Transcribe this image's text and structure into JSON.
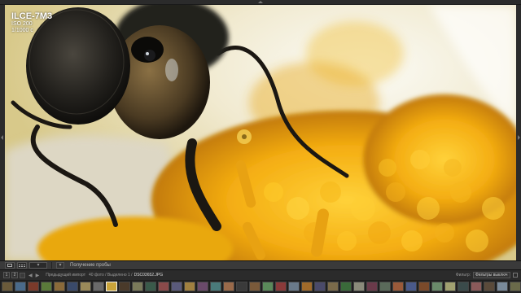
{
  "photo_info": {
    "camera": "ILCE-7M3",
    "iso": "ISO 200",
    "shutter": "1/1000 с"
  },
  "toolbar": {
    "label": "Получение пробы"
  },
  "filmstrip_header": {
    "num1": "1",
    "num2": "2",
    "source": "Предыдущий импорт",
    "count": "40 фото / Выделено 1 /",
    "selected_file": "DSC03652.JPG",
    "filter_label": "Фильтр:",
    "filter_value": "Фильтры выключ"
  },
  "filmstrip": {
    "selected_index": 8,
    "thumbs": [
      "#6a5a3a",
      "#4a6a8a",
      "#7a3a2a",
      "#5a7a3a",
      "#8a6a3a",
      "#3a4a6a",
      "#9a8a5a",
      "#6a6a6a",
      "#c9a43a",
      "#4a3a2a",
      "#7a7a5a",
      "#3a5a4a",
      "#8a4a4a",
      "#5a5a7a",
      "#a08040",
      "#6a4a6a",
      "#4a7a7a",
      "#9a6a4a",
      "#3a3a3a",
      "#7a5a3a",
      "#5a8a5a",
      "#8a3a3a",
      "#6a7a8a",
      "#a06a2a",
      "#4a4a6a",
      "#7a6a4a",
      "#3a6a3a",
      "#8a8a7a",
      "#6a3a4a",
      "#5a6a5a",
      "#9a5a3a",
      "#4a5a8a",
      "#7a4a2a",
      "#6a8a6a",
      "#a0a070",
      "#3a4a4a",
      "#8a5a5a",
      "#5a4a3a",
      "#7a8a9a",
      "#6a6a4a",
      "#4a3a5a",
      "#9a7a6a",
      "#5a5a5a",
      "#8a7a3a"
    ]
  }
}
